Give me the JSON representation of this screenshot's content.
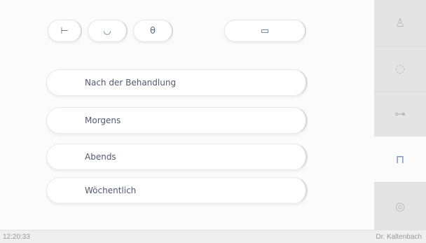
{
  "toolbar": {
    "buttons": [
      {
        "icon": "mouthpiece-icon",
        "glyph": "⊢"
      },
      {
        "icon": "spittoon-icon",
        "glyph": "◡"
      },
      {
        "icon": "cup-icon",
        "glyph": "θ"
      },
      {
        "icon": "screen-icon",
        "glyph": "▭"
      }
    ]
  },
  "menu": {
    "items": [
      {
        "label": "Nach der Behandlung"
      },
      {
        "label": "Morgens"
      },
      {
        "label": "Abends"
      },
      {
        "label": "Wöchentlich"
      }
    ]
  },
  "rail": {
    "items": [
      {
        "icon": "tooth-icon",
        "glyph": "♙",
        "active": false
      },
      {
        "icon": "timer-icon",
        "glyph": "◌",
        "active": false
      },
      {
        "icon": "key-icon",
        "glyph": "⊶",
        "active": false
      },
      {
        "icon": "cleaning-cup-icon",
        "glyph": "⊓",
        "active": true
      },
      {
        "icon": "settings-icon",
        "glyph": "◎",
        "active": false
      }
    ]
  },
  "status": {
    "time": "12:20:33",
    "user": "Dr. Kaltenbach"
  },
  "colors": {
    "accent": "#6e8fc7",
    "text": "#505a73"
  }
}
